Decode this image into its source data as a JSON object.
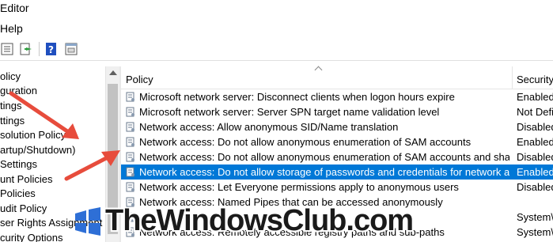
{
  "window": {
    "title": "Editor"
  },
  "menu": {
    "items": [
      "Help"
    ]
  },
  "toolbar": {
    "buttons": [
      "list-icon",
      "export-icon",
      "help-icon",
      "properties-icon"
    ]
  },
  "tree": {
    "items": [
      "olicy",
      "guration",
      "tings",
      "ttings",
      "solution Policy",
      "artup/Shutdown)",
      "Settings",
      "unt Policies",
      " Policies",
      "udit Policy",
      "ser Rights Assignment",
      "curity Options"
    ]
  },
  "list": {
    "columns": {
      "policy": "Policy",
      "setting": "Security"
    },
    "rows": [
      {
        "policy": "Microsoft network server: Disconnect clients when logon hours expire",
        "setting": "Enabled",
        "selected": false
      },
      {
        "policy": "Microsoft network server: Server SPN target name validation level",
        "setting": "Not Defi",
        "selected": false
      },
      {
        "policy": "Network access: Allow anonymous SID/Name translation",
        "setting": "Disabled",
        "selected": false
      },
      {
        "policy": "Network access: Do not allow anonymous enumeration of SAM accounts",
        "setting": "Enabled",
        "selected": false
      },
      {
        "policy": "Network access: Do not allow anonymous enumeration of SAM accounts and shares",
        "setting": "Disabled",
        "selected": false
      },
      {
        "policy": "Network access: Do not allow storage of passwords and credentials for network aut...",
        "setting": "Enabled",
        "selected": true
      },
      {
        "policy": "Network access: Let Everyone permissions apply to anonymous users",
        "setting": "Disabled",
        "selected": false
      },
      {
        "policy": "Network access: Named Pipes that can be accessed anonymously",
        "setting": "",
        "selected": false
      },
      {
        "policy": "",
        "setting": "System\\",
        "selected": false
      },
      {
        "policy": "Network access: Remotely accessible registry paths and sub-paths",
        "setting": "System\\",
        "selected": false
      }
    ]
  },
  "watermark": {
    "text": "TheWindowsClub.com"
  },
  "colors": {
    "selection": "#0078d7",
    "arrow": "#e74c3c",
    "watermark_logo": "#2e6fd6"
  }
}
